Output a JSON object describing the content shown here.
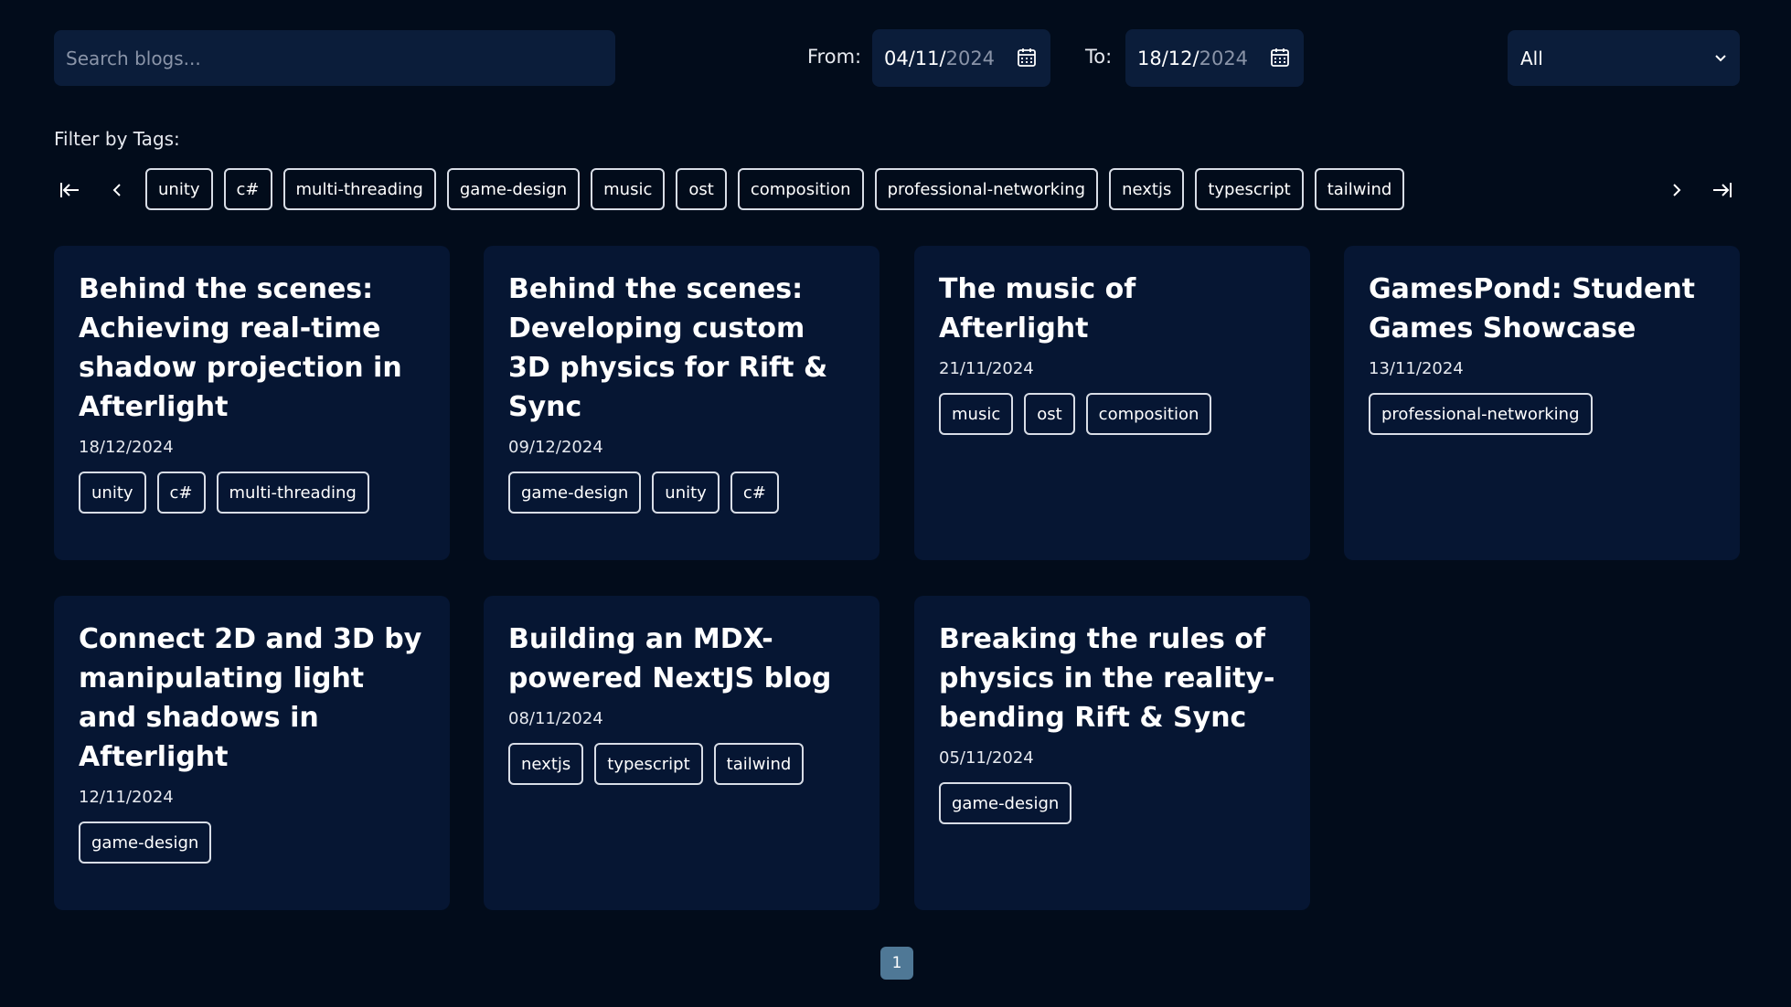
{
  "search": {
    "placeholder": "Search blogs..."
  },
  "date_filter": {
    "from_label": "From:",
    "from_day_month": "04/11/",
    "from_year": "2024",
    "to_label": "To:",
    "to_day_month": "18/12/",
    "to_year": "2024"
  },
  "category_select": {
    "value": "All"
  },
  "tag_filter": {
    "title": "Filter by Tags:",
    "tags": [
      "unity",
      "c#",
      "multi-threading",
      "game-design",
      "music",
      "ost",
      "composition",
      "professional-networking",
      "nextjs",
      "typescript",
      "tailwind"
    ]
  },
  "posts": [
    {
      "title": "Behind the scenes: Achieving real-time shadow projection in Afterlight",
      "date": "18/12/2024",
      "tags": [
        "unity",
        "c#",
        "multi-threading"
      ]
    },
    {
      "title": "Behind the scenes: Developing custom 3D physics for Rift & Sync",
      "date": "09/12/2024",
      "tags": [
        "game-design",
        "unity",
        "c#"
      ]
    },
    {
      "title": "The music of Afterlight",
      "date": "21/11/2024",
      "tags": [
        "music",
        "ost",
        "composition"
      ]
    },
    {
      "title": "GamesPond: Student Games Showcase",
      "date": "13/11/2024",
      "tags": [
        "professional-networking"
      ]
    },
    {
      "title": "Connect 2D and 3D by manipulating light and shadows in Afterlight",
      "date": "12/11/2024",
      "tags": [
        "game-design"
      ]
    },
    {
      "title": "Building an MDX-powered NextJS blog",
      "date": "08/11/2024",
      "tags": [
        "nextjs",
        "typescript",
        "tailwind"
      ]
    },
    {
      "title": "Breaking the rules of physics in the reality-bending Rift & Sync",
      "date": "05/11/2024",
      "tags": [
        "game-design"
      ]
    }
  ],
  "pagination": {
    "current_page": "1"
  }
}
